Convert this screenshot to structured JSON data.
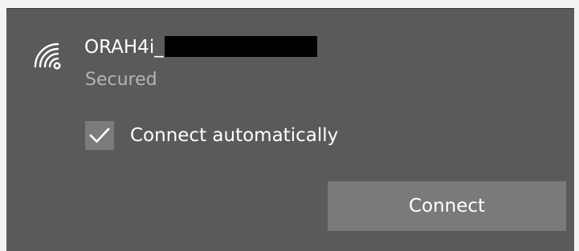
{
  "network": {
    "ssid_visible": "ORAH4i_",
    "status": "Secured",
    "icon": "wifi-secured-icon"
  },
  "options": {
    "connect_automatically_label": "Connect automatically",
    "connect_automatically_checked": true
  },
  "actions": {
    "connect_label": "Connect"
  },
  "colors": {
    "panel_background": "#5a5a5a",
    "button_background": "#7a7a7a",
    "checkbox_background": "#7b7b7b",
    "secondary_text": "#b4b4b4",
    "primary_text": "#ffffff"
  }
}
